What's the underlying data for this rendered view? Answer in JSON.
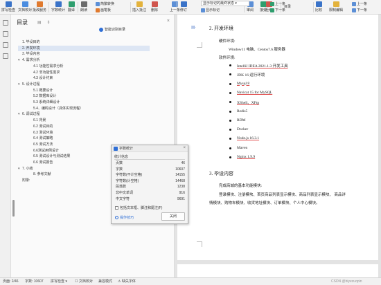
{
  "ribbon": {
    "big_buttons": [
      {
        "label": "拼写检查",
        "icon": "spell-check-icon",
        "color": "#3a73c8"
      },
      {
        "label": "文档校对",
        "icon": "proofread-icon",
        "color": "#4b8de0"
      },
      {
        "label": "批改服务",
        "icon": "correction-service-icon",
        "color": "#e07a2e"
      },
      {
        "label": "字数统计",
        "icon": "word-count-icon",
        "color": "#3a73c8"
      },
      {
        "label": "翻译",
        "icon": "translate-icon",
        "color": "#2f9e6e"
      },
      {
        "label": "朗读",
        "icon": "read-aloud-icon",
        "color": "#6a6a6a"
      },
      {
        "label": "插入批注",
        "icon": "insert-comment-icon",
        "color": "#e3b23c"
      },
      {
        "label": "删除",
        "icon": "delete-comment-icon",
        "color": "#d0554d"
      },
      {
        "label": "上一条",
        "icon": "prev-comment-icon",
        "color": "#5c8fd6"
      },
      {
        "label": "修订",
        "icon": "track-changes-icon",
        "color": "#3a73c8"
      },
      {
        "label": "审阅",
        "icon": "review-icon",
        "color": "#5c8fd6"
      },
      {
        "label": "接受",
        "icon": "accept-icon",
        "color": "#2f9e6e"
      },
      {
        "label": "拒绝",
        "icon": "reject-icon",
        "color": "#d0554d"
      },
      {
        "label": "比较",
        "icon": "compare-icon",
        "color": "#3a73c8"
      },
      {
        "label": "限制编辑",
        "icon": "restrict-edit-icon",
        "color": "#e3b23c"
      }
    ],
    "small_buttons": {
      "simp_trad": "简繁转换",
      "commentator": "画笔板",
      "show_comments": "显示批注",
      "show_markup": "显示标记",
      "prev_change": "上一条",
      "next_change": "下一条",
      "chapter": "章节",
      "doc_permission": "文档权限",
      "prev": "上一条",
      "next": "下一条"
    },
    "markup_select": "显示标记的最终状态",
    "toc_button": "目录"
  },
  "toc": {
    "title": "目录",
    "smart_toc": "智能识别目录",
    "items": [
      {
        "label": "1. 毕设目的",
        "indent": 1,
        "arrow": "",
        "selected": false
      },
      {
        "label": "2. 开发环境",
        "indent": 1,
        "arrow": "",
        "selected": true
      },
      {
        "label": "3. 毕设内容",
        "indent": 1,
        "arrow": "",
        "selected": false
      },
      {
        "label": "4. 需求分析",
        "indent": 1,
        "arrow": "▾",
        "selected": false
      },
      {
        "label": "4.1 功能性需求分析",
        "indent": 2,
        "arrow": "",
        "selected": false
      },
      {
        "label": "4.2 非功能性需求",
        "indent": 2,
        "arrow": "",
        "selected": false
      },
      {
        "label": "4.3 设计约束",
        "indent": 2,
        "arrow": "",
        "selected": false
      },
      {
        "label": "5. 设计过程",
        "indent": 1,
        "arrow": "▾",
        "selected": false
      },
      {
        "label": "5.1 概要设计",
        "indent": 2,
        "arrow": "",
        "selected": false
      },
      {
        "label": "5.2 数据库设计",
        "indent": 2,
        "arrow": "",
        "selected": false
      },
      {
        "label": "5.3 系统详细设计",
        "indent": 2,
        "arrow": "",
        "selected": false
      },
      {
        "label": "5.4、编码设计（具体实现流程）",
        "indent": 2,
        "arrow": "",
        "selected": false
      },
      {
        "label": "6. 调试过程",
        "indent": 1,
        "arrow": "▾",
        "selected": false
      },
      {
        "label": "6.1 背景",
        "indent": 2,
        "arrow": "",
        "selected": false
      },
      {
        "label": "6.2 测试目的",
        "indent": 2,
        "arrow": "",
        "selected": false
      },
      {
        "label": "6.3 测试环境",
        "indent": 2,
        "arrow": "",
        "selected": false
      },
      {
        "label": "6.4 测试策略",
        "indent": 2,
        "arrow": "",
        "selected": false
      },
      {
        "label": "6.5 测试方法",
        "indent": 2,
        "arrow": "",
        "selected": false
      },
      {
        "label": "6.6测试用例设计",
        "indent": 2,
        "arrow": "",
        "selected": false
      },
      {
        "label": "6.5 测试设计与测试结果",
        "indent": 2,
        "arrow": "",
        "selected": false
      },
      {
        "label": "6.6 测试报告",
        "indent": 2,
        "arrow": "",
        "selected": false
      },
      {
        "label": "7. 小结",
        "indent": 1,
        "arrow": "▾",
        "selected": false
      },
      {
        "label": "8. 参考文献",
        "indent": 2,
        "arrow": "",
        "selected": false
      },
      {
        "label": "附录:",
        "indent": 1,
        "arrow": "",
        "selected": false
      }
    ]
  },
  "document": {
    "section2_title": "2. 开发环境",
    "hardware_label": "硬件环境:",
    "hardware_value": "Window11 电脑、Centos7.6 服务器",
    "software_label": "软件环境:",
    "software_items": [
      {
        "text": "IntelliJ IDEA 2021.1.3 开发工具",
        "underline": true
      },
      {
        "text": "JDK 16 运行环境",
        "underline": false
      },
      {
        "text": "Mysql 8",
        "underline": true
      },
      {
        "text": "Navicat 15 for MySQL",
        "underline": true
      },
      {
        "text": "XShell、XFtp",
        "underline": true
      },
      {
        "text": "Redis5",
        "underline": false
      },
      {
        "text": "RDM",
        "underline": false
      },
      {
        "text": "Docker",
        "underline": false
      },
      {
        "text": "Node.js 16.3.1",
        "underline": true
      },
      {
        "text": "Maven",
        "underline": false
      },
      {
        "text": "Nginx 1.9.9",
        "underline": true
      }
    ],
    "section3_title": "3. 毕设内容",
    "section3_intro": "完成商城的基本功能模块:",
    "section3_line1": "登录模块、注册模块、首页商品列表显示模块、商品列表显示模块、 商品详",
    "section3_line2": "情模块、购物车模块、收货地址模块、订单模块、个人中心模块。"
  },
  "dialog": {
    "title": "字数统计",
    "section": "统计信息",
    "stats": [
      {
        "label": "页数",
        "value": "46"
      },
      {
        "label": "字数",
        "value": "10607"
      },
      {
        "label": "字符数(不计空格)",
        "value": "14155"
      },
      {
        "label": "字符数(计空格)",
        "value": "14468"
      },
      {
        "label": "段落数",
        "value": "1238"
      },
      {
        "label": "非中文单词",
        "value": "916"
      },
      {
        "label": "中文字符",
        "value": "9691"
      }
    ],
    "include_label": "包括文本框、脚注和尾注(F)",
    "tips_link": "操作技巧",
    "close_button": "关闭"
  },
  "status": {
    "page": "页面: 2/46",
    "words": "字数: 10607",
    "spell": "拼写检查",
    "proof": "文档校对",
    "compat": "兼容模式",
    "missing_font": "缺失字体",
    "watermark": "CSDN @biyezuopin"
  }
}
